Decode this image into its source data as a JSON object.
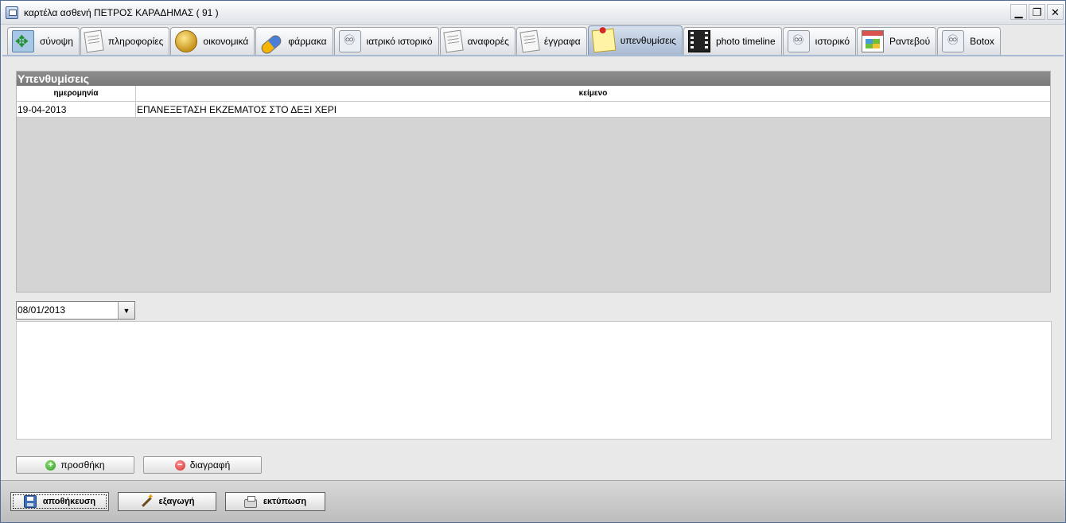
{
  "window": {
    "title": "καρτέλα ασθενή ΠΕΤΡΟΣ ΚΑΡΑΔΗΜΑΣ ( 91 )",
    "controls": {
      "minimize": "▁",
      "restore": "❐",
      "close": "✕"
    }
  },
  "tabs": [
    {
      "label": "σύνοψη",
      "icon": "overview-icon"
    },
    {
      "label": "πληροφορίες",
      "icon": "info-document-icon"
    },
    {
      "label": "οικονομικά",
      "icon": "coins-icon"
    },
    {
      "label": "φάρμακα",
      "icon": "pill-icon"
    },
    {
      "label": "ιατρικό ιστορικό",
      "icon": "stethoscope-icon"
    },
    {
      "label": "αναφορές",
      "icon": "report-icon"
    },
    {
      "label": "έγγραφα",
      "icon": "document-icon"
    },
    {
      "label": "υπενθυμίσεις",
      "icon": "sticky-note-icon",
      "active": true
    },
    {
      "label": "photo timeline",
      "icon": "film-icon"
    },
    {
      "label": "ιστορικό",
      "icon": "stethoscope-icon"
    },
    {
      "label": "Ραντεβού",
      "icon": "calendar-icon"
    },
    {
      "label": "Botox",
      "icon": "stethoscope-icon"
    }
  ],
  "reminders": {
    "title": "Υπενθυμίσεις",
    "columns": {
      "date": "ημερομηνία",
      "text": "κείμενο"
    },
    "rows": [
      {
        "date": "19-04-2013",
        "text": "ΕΠΑΝΕΞΕΤΑΣΗ ΕΚΖΕΜΑΤΟΣ ΣΤΟ ΔΕΞΙ ΧΕΡΙ"
      }
    ]
  },
  "editor": {
    "date_value": "08/01/2013",
    "dropdown_glyph": "▼",
    "text_value": ""
  },
  "actions": {
    "add": "προσθήκη",
    "delete": "διαγραφή",
    "add_glyph": "+",
    "delete_glyph": "−"
  },
  "footer": {
    "save": "αποθήκευση",
    "export": "εξαγωγή",
    "print": "εκτύπωση"
  },
  "colors": {
    "active_tab": "#bccbdf",
    "panel_header": "#7a7a7a",
    "add_icon": "#2b9a1c",
    "delete_icon": "#d22a2a"
  }
}
